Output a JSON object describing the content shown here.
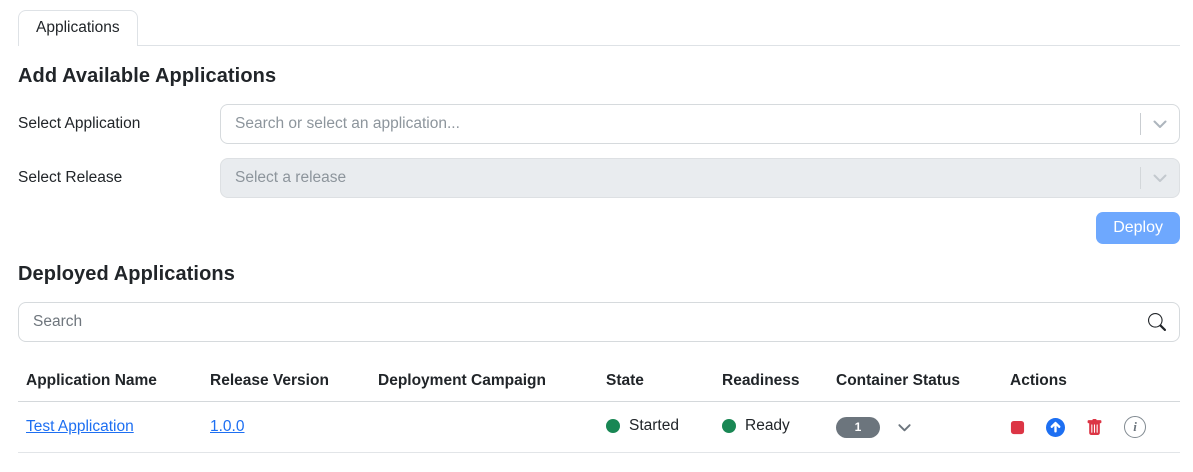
{
  "tabs": {
    "active_label": "Applications"
  },
  "add_section": {
    "title": "Add Available Applications",
    "select_application": {
      "label": "Select Application",
      "placeholder": "Search or select an application..."
    },
    "select_release": {
      "label": "Select Release",
      "placeholder": "Select a release",
      "disabled": true
    },
    "deploy_label": "Deploy"
  },
  "deployed_section": {
    "title": "Deployed Applications",
    "search_placeholder": "Search",
    "table": {
      "headers": [
        "Application Name",
        "Release Version",
        "Deployment Campaign",
        "State",
        "Readiness",
        "Container Status",
        "Actions"
      ],
      "rows": [
        {
          "application_name": "Test Application",
          "release_version": "1.0.0",
          "deployment_campaign": "",
          "state": "Started",
          "readiness": "Ready",
          "container_count": "1",
          "actions": [
            "stop",
            "upgrade",
            "delete",
            "info"
          ]
        }
      ]
    }
  },
  "icons": {
    "chevron": "chevron-down",
    "search": "magnifier",
    "stop": "stop-square",
    "upgrade": "arrow-up-circle",
    "delete": "trash",
    "info": "info-circle",
    "info_glyph": "i"
  },
  "colors": {
    "deploy_button": "#6ea8fe",
    "link_blue": "#1d6ff2",
    "status_green": "#198754",
    "container_badge_gray": "#6c757d",
    "stop_red": "#dc3545",
    "upgrade_blue": "#1d6ff2",
    "trash_red": "#dc3545",
    "border_gray": "#dee2e6",
    "disabled_input_bg": "#e9ecef"
  }
}
